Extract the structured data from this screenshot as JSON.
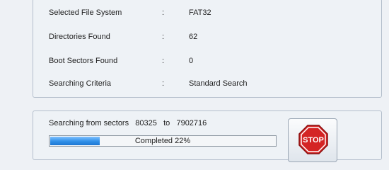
{
  "info": {
    "rows": [
      {
        "label": "Selected File System",
        "sep": ":",
        "value": "FAT32"
      },
      {
        "label": "Directories Found",
        "sep": ":",
        "value": "62"
      },
      {
        "label": "Boot Sectors Found",
        "sep": ":",
        "value": "0"
      },
      {
        "label": "Searching Criteria",
        "sep": ":",
        "value": "Standard Search"
      }
    ]
  },
  "search": {
    "prefix": "Searching from sectors",
    "start": "80325",
    "to": "to",
    "end": "7902716"
  },
  "progress": {
    "text": "Completed 22%",
    "fraction": 0.22
  },
  "stop_button": {
    "label": "STOP",
    "icon": "stop-sign-icon",
    "color": "#d42424"
  }
}
